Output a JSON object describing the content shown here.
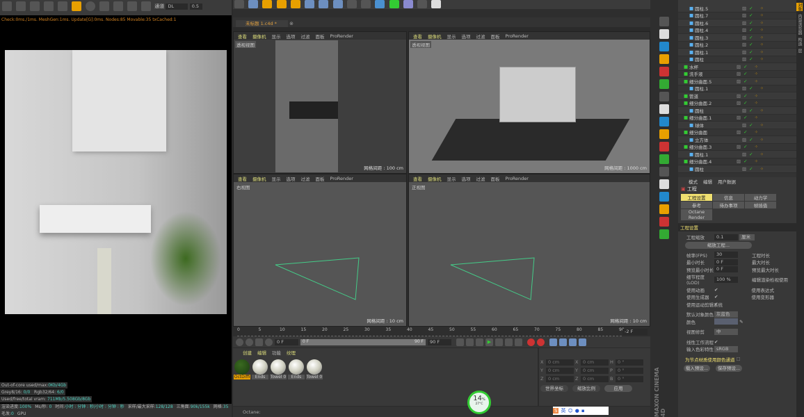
{
  "render_panel": {
    "channel_label": "通道",
    "channel_value": "DL",
    "value": "0.5",
    "status_line": "Check:0ms./1ms. MeshGen:1ms. Update[G]:0ms. Nodes:85 Movable:35 txCached:1",
    "stats": [
      {
        "label": "Out-of-core used/max:",
        "value": "0Kb/4Gb"
      },
      {
        "label": "Grey8/16: ",
        "value": "0/0",
        "label2": "Rgb32/64: ",
        "value2": "6/0"
      },
      {
        "label": "Used/free/total vram: ",
        "value": "711Mb/5.508Gb/8Gb"
      }
    ],
    "bottom": [
      {
        "label": "渲染进度:",
        "value": "100%"
      },
      {
        "label": "Ms/秒: ",
        "value": "0"
      },
      {
        "label": "时间:",
        "value": "小时 : 分钟 : 秒/小时 : 分钟 : 秒"
      },
      {
        "label": "采样/最大采样:",
        "value": "128/128"
      },
      {
        "label": "三角面:",
        "value": "90k/155k"
      },
      {
        "label": "网格:",
        "value": "35"
      },
      {
        "label": "毛发:",
        "value": "0"
      },
      {
        "label": "GPU",
        "value": ""
      }
    ]
  },
  "document_tab": "未标题 1.c4d *",
  "viewport_menu": [
    "查看",
    "摄像机",
    "显示",
    "选项",
    "过滤",
    "面板",
    "ProRender"
  ],
  "viewports": [
    {
      "label": "透视视图",
      "grid": "网格间距 : 100 cm"
    },
    {
      "label": "透视视图",
      "grid": "网格间距 : 1000 cm"
    },
    {
      "label": "右视图",
      "grid": "网格间距 : 10 cm"
    },
    {
      "label": "正视图",
      "grid": "网格间距 : 10 cm"
    }
  ],
  "timeline": {
    "ticks": [
      "0",
      "5",
      "10",
      "15",
      "20",
      "25",
      "30",
      "35",
      "40",
      "45",
      "50",
      "55",
      "60",
      "65",
      "70",
      "75",
      "80",
      "85",
      "90"
    ],
    "current": "-2 F",
    "start": "0 F",
    "range_start": "0 F",
    "range_end": "90 F",
    "end": "90 F"
  },
  "materials": {
    "menu": [
      "创建",
      "编辑",
      "功能",
      "纹理"
    ],
    "items": [
      "OctDiffi",
      "Ends",
      "Towel 0",
      "Ends",
      "Towel 0"
    ]
  },
  "coords": {
    "rows": [
      [
        "X",
        "0 cm",
        "X",
        "0 cm",
        "H",
        "0 °"
      ],
      [
        "Y",
        "0 cm",
        "Y",
        "0 cm",
        "P",
        "0 °"
      ],
      [
        "Z",
        "0 cm",
        "Z",
        "0 cm",
        "B",
        "0 °"
      ]
    ],
    "mode1": "世界坐标",
    "mode2": "缩放比例",
    "apply": "应用"
  },
  "status_bar": "Octane:",
  "gpu_widget": {
    "percent": "14",
    "unit": "%",
    "temp": "27°C"
  },
  "objects": [
    {
      "name": "圆柱.5",
      "indent": 1
    },
    {
      "name": "圆柱.7",
      "indent": 1
    },
    {
      "name": "圆柱.6",
      "indent": 1
    },
    {
      "name": "圆柱.4",
      "indent": 1
    },
    {
      "name": "圆柱.3",
      "indent": 1
    },
    {
      "name": "圆柱.2",
      "indent": 1
    },
    {
      "name": "圆柱.1",
      "indent": 1
    },
    {
      "name": "圆柱",
      "indent": 1
    },
    {
      "name": "水杯",
      "indent": 0
    },
    {
      "name": "洗手液",
      "indent": 0
    },
    {
      "name": "细分曲面.5",
      "indent": 0
    },
    {
      "name": "圆柱.1",
      "indent": 1
    },
    {
      "name": "管道",
      "indent": 0
    },
    {
      "name": "细分曲面.2",
      "indent": 0
    },
    {
      "name": "圆柱",
      "indent": 1
    },
    {
      "name": "细分曲面.1",
      "indent": 0
    },
    {
      "name": "球体",
      "indent": 1
    },
    {
      "name": "细分曲面",
      "indent": 0
    },
    {
      "name": "立方体",
      "indent": 1
    },
    {
      "name": "细分曲面.3",
      "indent": 0
    },
    {
      "name": "圆柱.1",
      "indent": 1
    },
    {
      "name": "细分曲面.4",
      "indent": 0
    },
    {
      "name": "圆柱",
      "indent": 1
    }
  ],
  "attributes": {
    "menu": [
      "模式",
      "编辑",
      "用户数据"
    ],
    "title": "工程",
    "tabs": [
      "工程设置",
      "信息",
      "动力学",
      "参考",
      "待办事项",
      "帧插值",
      "Octane Render"
    ],
    "section": "工程设置",
    "scale_label": "工程缩放",
    "scale_value": "0.1",
    "scale_unit": "厘米",
    "scale_btn": "缩放工程...",
    "fps_label": "帧率(FPS)",
    "fps": "30",
    "duration_label": "工程时长",
    "min_label": "最小时长",
    "min": "0 F",
    "max_label": "最大时长",
    "pmin_label": "预览最小时长",
    "pmin": "0 F",
    "pmax_label": "预览最大时长",
    "lod_label": "细节程度(LOD)",
    "lod": "100 %",
    "lod_right": "编辑渲染检视使用",
    "checks": [
      "使用动画",
      "使用生成器",
      "使用运动剪辑系统"
    ],
    "checks_right": [
      "使用表达式",
      "使用变形器"
    ],
    "defcolor_label": "默认对象颜色",
    "defcolor": "灰蓝色",
    "color_label": "颜色",
    "clip_label": "视图修剪",
    "clip": "中",
    "linear_label": "线性工作流程",
    "input_label": "输入色彩特性",
    "input": "sRGB",
    "node_label": "为节点材质使用颜色通道",
    "load": "载入预设...",
    "save": "保存预设..."
  },
  "right_tabs": [
    "对象",
    "内容浏览器",
    "构造",
    "层"
  ],
  "brand": "MAXON CINEMA 4D",
  "ime": "英"
}
